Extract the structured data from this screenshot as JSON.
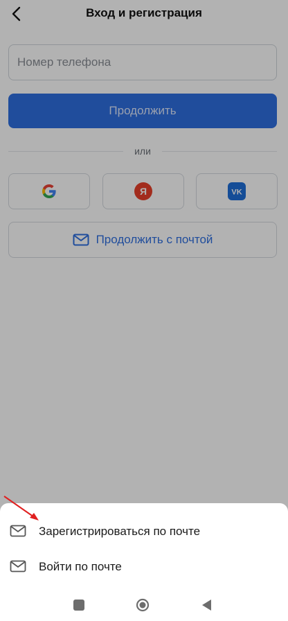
{
  "header": {
    "title": "Вход и регистрация"
  },
  "phone": {
    "placeholder": "Номер телефона"
  },
  "continue_label": "Продолжить",
  "divider_text": "или",
  "social": [
    {
      "name": "google",
      "icon": "google-icon"
    },
    {
      "name": "yandex",
      "icon": "yandex-icon",
      "glyph": "Я"
    },
    {
      "name": "vk",
      "icon": "vk-icon",
      "glyph": "VK"
    }
  ],
  "email_continue_label": "Продолжить с почтой",
  "sheet": {
    "options": [
      {
        "label": "Зарегистрироваться по почте",
        "icon": "mail-icon"
      },
      {
        "label": "Войти по почте",
        "icon": "mail-icon"
      }
    ]
  },
  "colors": {
    "primary": "#2f6fe0",
    "overlay": "rgba(0,0,0,0.30)",
    "annotation_arrow": "#e02020",
    "yandex": "#e8402a",
    "vk": "#1f6fd9"
  }
}
